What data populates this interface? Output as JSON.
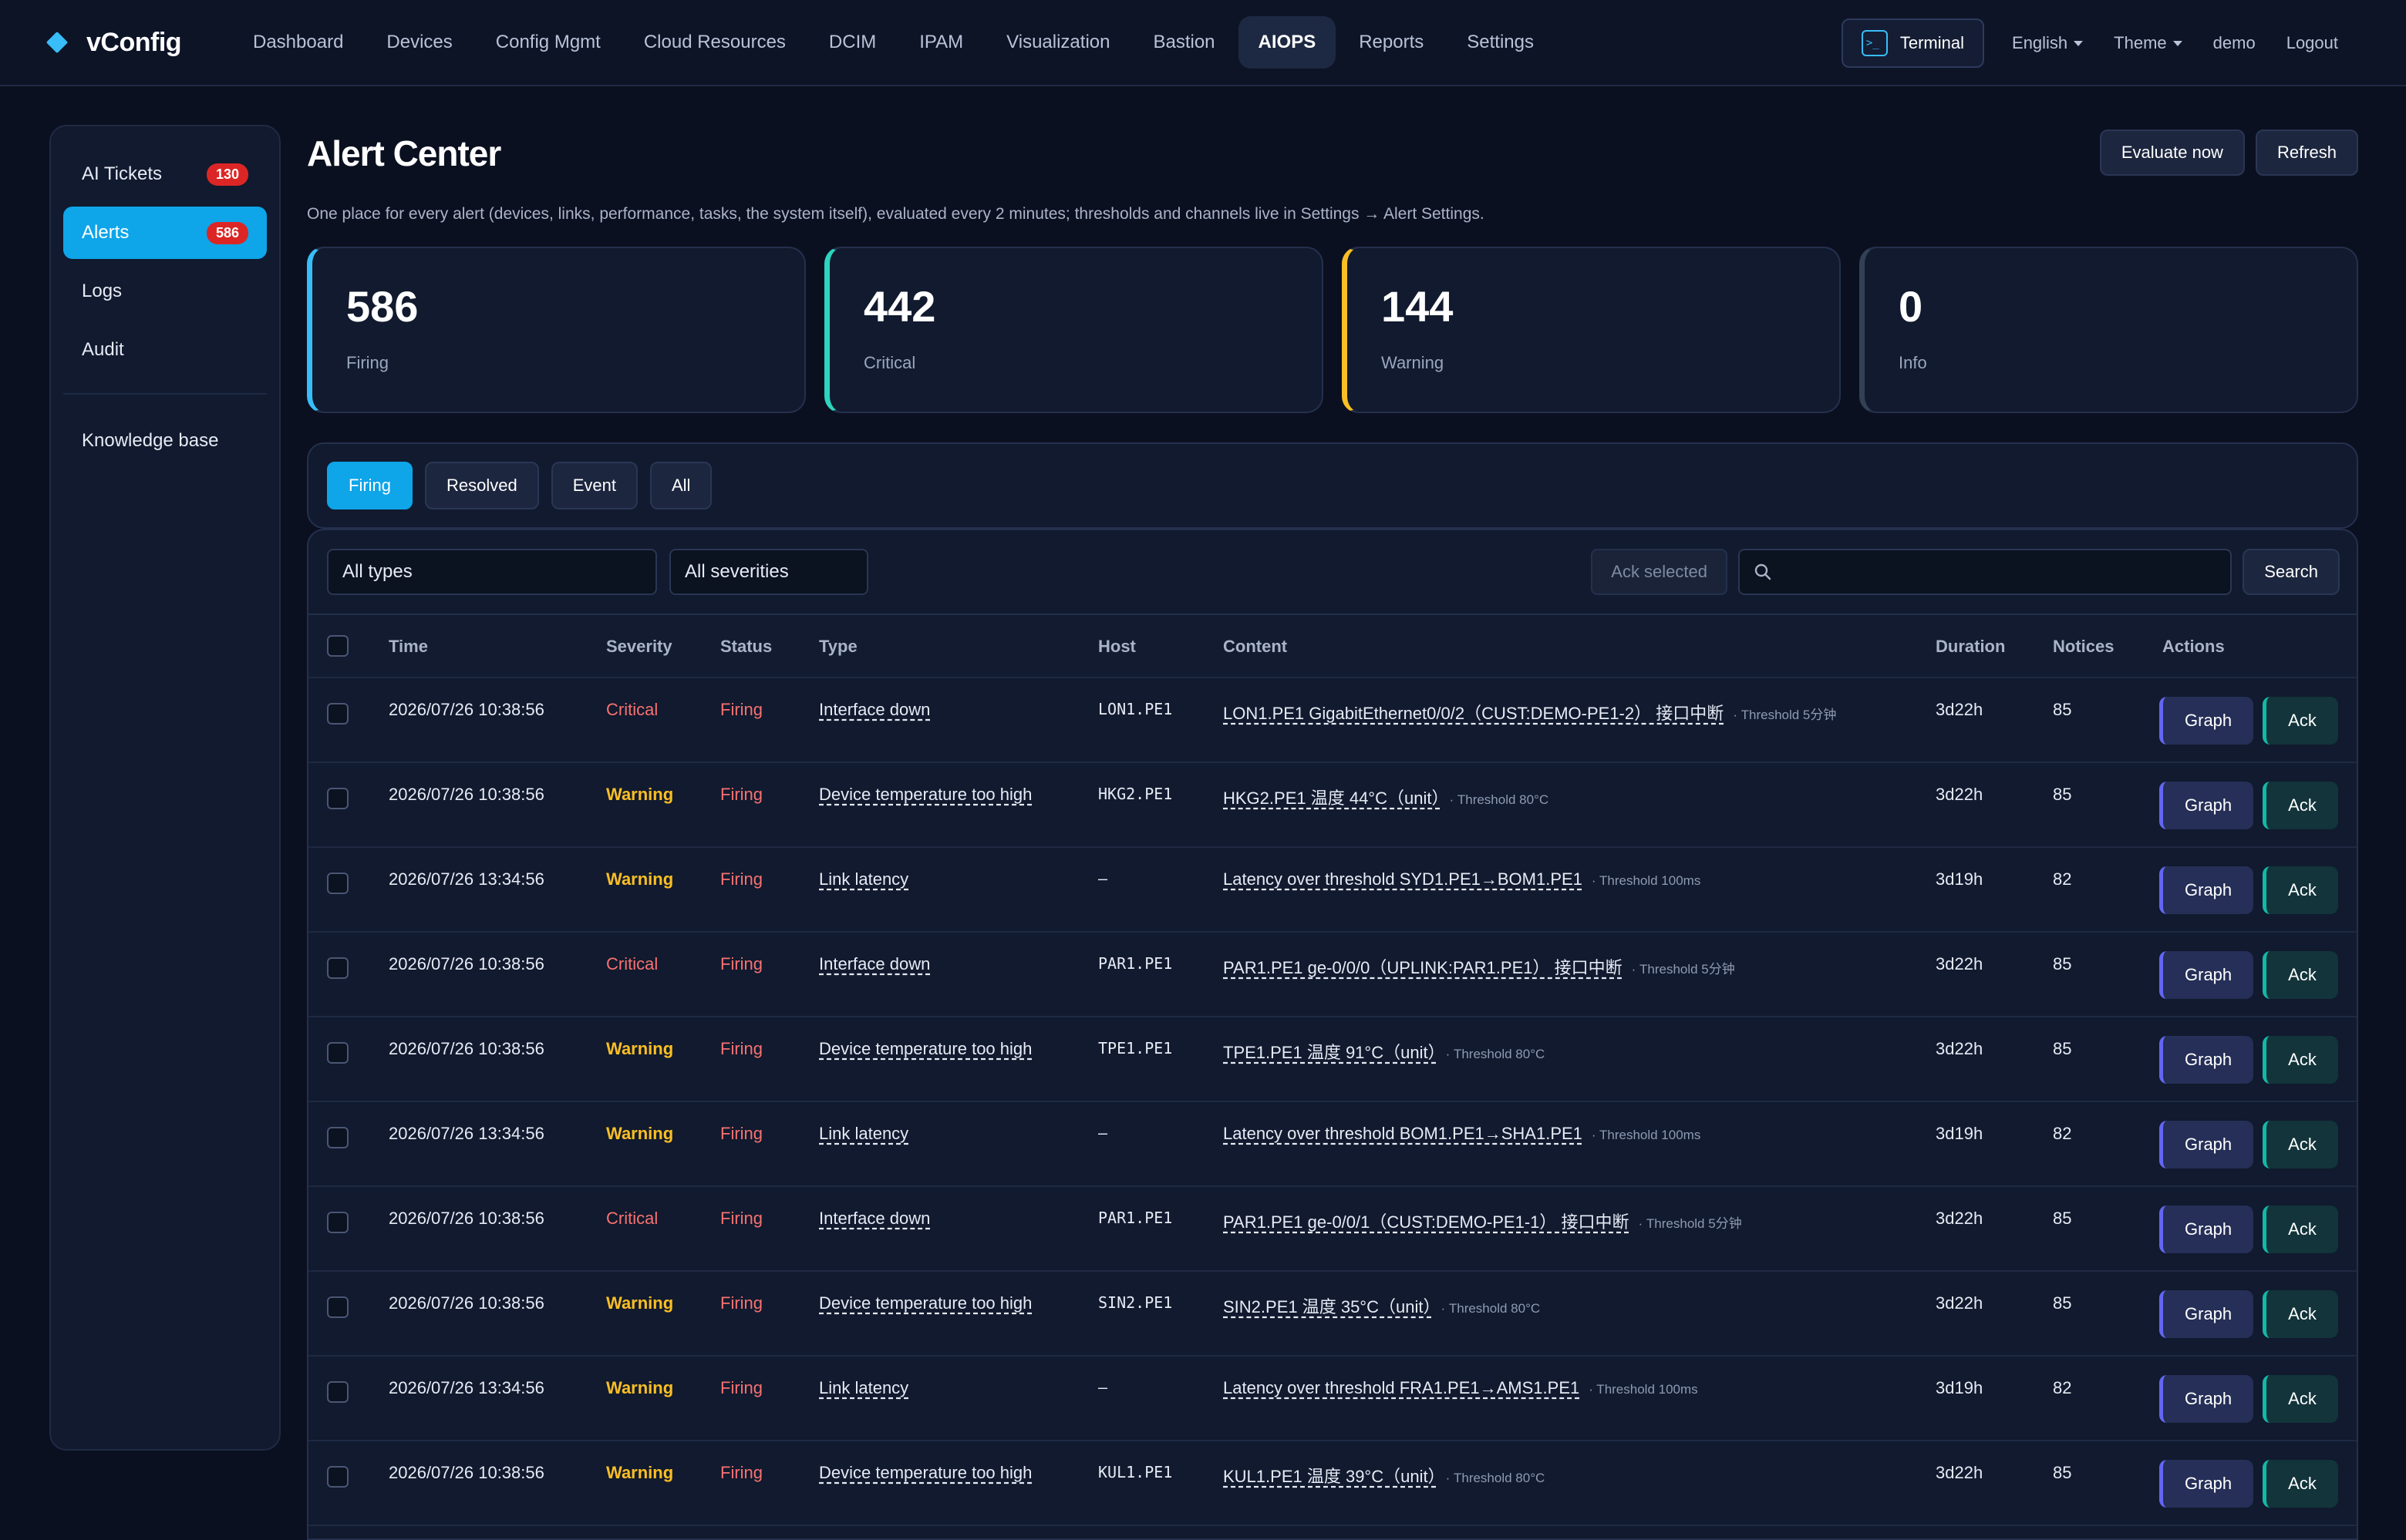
{
  "brand": "vConfig",
  "nav": [
    "Dashboard",
    "Devices",
    "Config Mgmt",
    "Cloud Resources",
    "DCIM",
    "IPAM",
    "Visualization",
    "Bastion",
    "AIOPS",
    "Reports",
    "Settings"
  ],
  "topbar": {
    "terminal_label": "Terminal",
    "language": "English",
    "theme": "Theme",
    "user": "demo",
    "logout": "Logout"
  },
  "sidebar": {
    "items": [
      {
        "label": "AI Tickets",
        "badge": "130"
      },
      {
        "label": "Alerts",
        "badge": "586"
      },
      {
        "label": "Logs"
      },
      {
        "label": "Audit"
      }
    ],
    "knowledge": "Knowledge base"
  },
  "page": {
    "title": "Alert Center",
    "subtitle": "One place for every alert (devices, links, performance, tasks, the system itself), evaluated every 2 minutes; thresholds and channels live in Settings → Alert Settings.",
    "evaluate_label": "Evaluate now",
    "refresh_label": "Refresh"
  },
  "stats": [
    {
      "value": "586",
      "label": "Firing",
      "color": "#38bdf8"
    },
    {
      "value": "442",
      "label": "Critical",
      "color": "#2dd4bf"
    },
    {
      "value": "144",
      "label": "Warning",
      "color": "#fbbf24"
    },
    {
      "value": "0",
      "label": "Info",
      "color": "#334155"
    }
  ],
  "tabs": [
    "Firing",
    "Resolved",
    "Event",
    "All"
  ],
  "filters": {
    "type": "All types",
    "severity": "All severities",
    "ack_selected": "Ack selected",
    "search_placeholder": "",
    "search_label": "Search"
  },
  "table": {
    "columns": [
      "Time",
      "Severity",
      "Status",
      "Type",
      "Host",
      "Content",
      "Duration",
      "Notices",
      "Actions"
    ],
    "graph_label": "Graph",
    "ack_label": "Ack",
    "rows": [
      {
        "time": "2026/07/26 10:38:56",
        "severity": "Critical",
        "status": "Firing",
        "type": "Interface down",
        "host": "LON1.PE1",
        "content": "LON1.PE1 GigabitEthernet0/0/2（CUST:DEMO-PE1-2） 接口中断",
        "threshold": "· Threshold 5分钟",
        "duration": "3d22h",
        "notices": "85"
      },
      {
        "time": "2026/07/26 10:38:56",
        "severity": "Warning",
        "status": "Firing",
        "type": "Device temperature too high",
        "host": "HKG2.PE1",
        "content": "HKG2.PE1 温度 44°C（unit）",
        "threshold": "· Threshold 80°C",
        "duration": "3d22h",
        "notices": "85"
      },
      {
        "time": "2026/07/26 13:34:56",
        "severity": "Warning",
        "status": "Firing",
        "type": "Link latency",
        "host": "—",
        "content": "Latency over threshold SYD1.PE1→BOM1.PE1",
        "threshold": "· Threshold 100ms",
        "duration": "3d19h",
        "notices": "82"
      },
      {
        "time": "2026/07/26 10:38:56",
        "severity": "Critical",
        "status": "Firing",
        "type": "Interface down",
        "host": "PAR1.PE1",
        "content": "PAR1.PE1 ge-0/0/0（UPLINK:PAR1.PE1） 接口中断",
        "threshold": "· Threshold 5分钟",
        "duration": "3d22h",
        "notices": "85"
      },
      {
        "time": "2026/07/26 10:38:56",
        "severity": "Warning",
        "status": "Firing",
        "type": "Device temperature too high",
        "host": "TPE1.PE1",
        "content": "TPE1.PE1 温度 91°C（unit）",
        "threshold": "· Threshold 80°C",
        "duration": "3d22h",
        "notices": "85"
      },
      {
        "time": "2026/07/26 13:34:56",
        "severity": "Warning",
        "status": "Firing",
        "type": "Link latency",
        "host": "—",
        "content": "Latency over threshold BOM1.PE1→SHA1.PE1",
        "threshold": "· Threshold 100ms",
        "duration": "3d19h",
        "notices": "82"
      },
      {
        "time": "2026/07/26 10:38:56",
        "severity": "Critical",
        "status": "Firing",
        "type": "Interface down",
        "host": "PAR1.PE1",
        "content": "PAR1.PE1 ge-0/0/1（CUST:DEMO-PE1-1） 接口中断",
        "threshold": "· Threshold 5分钟",
        "duration": "3d22h",
        "notices": "85"
      },
      {
        "time": "2026/07/26 10:38:56",
        "severity": "Warning",
        "status": "Firing",
        "type": "Device temperature too high",
        "host": "SIN2.PE1",
        "content": "SIN2.PE1 温度 35°C（unit）",
        "threshold": "· Threshold 80°C",
        "duration": "3d22h",
        "notices": "85"
      },
      {
        "time": "2026/07/26 13:34:56",
        "severity": "Warning",
        "status": "Firing",
        "type": "Link latency",
        "host": "—",
        "content": "Latency over threshold FRA1.PE1→AMS1.PE1",
        "threshold": "· Threshold 100ms",
        "duration": "3d19h",
        "notices": "82"
      },
      {
        "time": "2026/07/26 10:38:56",
        "severity": "Warning",
        "status": "Firing",
        "type": "Device temperature too high",
        "host": "KUL1.PE1",
        "content": "KUL1.PE1 温度 39°C（unit）",
        "threshold": "· Threshold 80°C",
        "duration": "3d22h",
        "notices": "85"
      }
    ]
  }
}
